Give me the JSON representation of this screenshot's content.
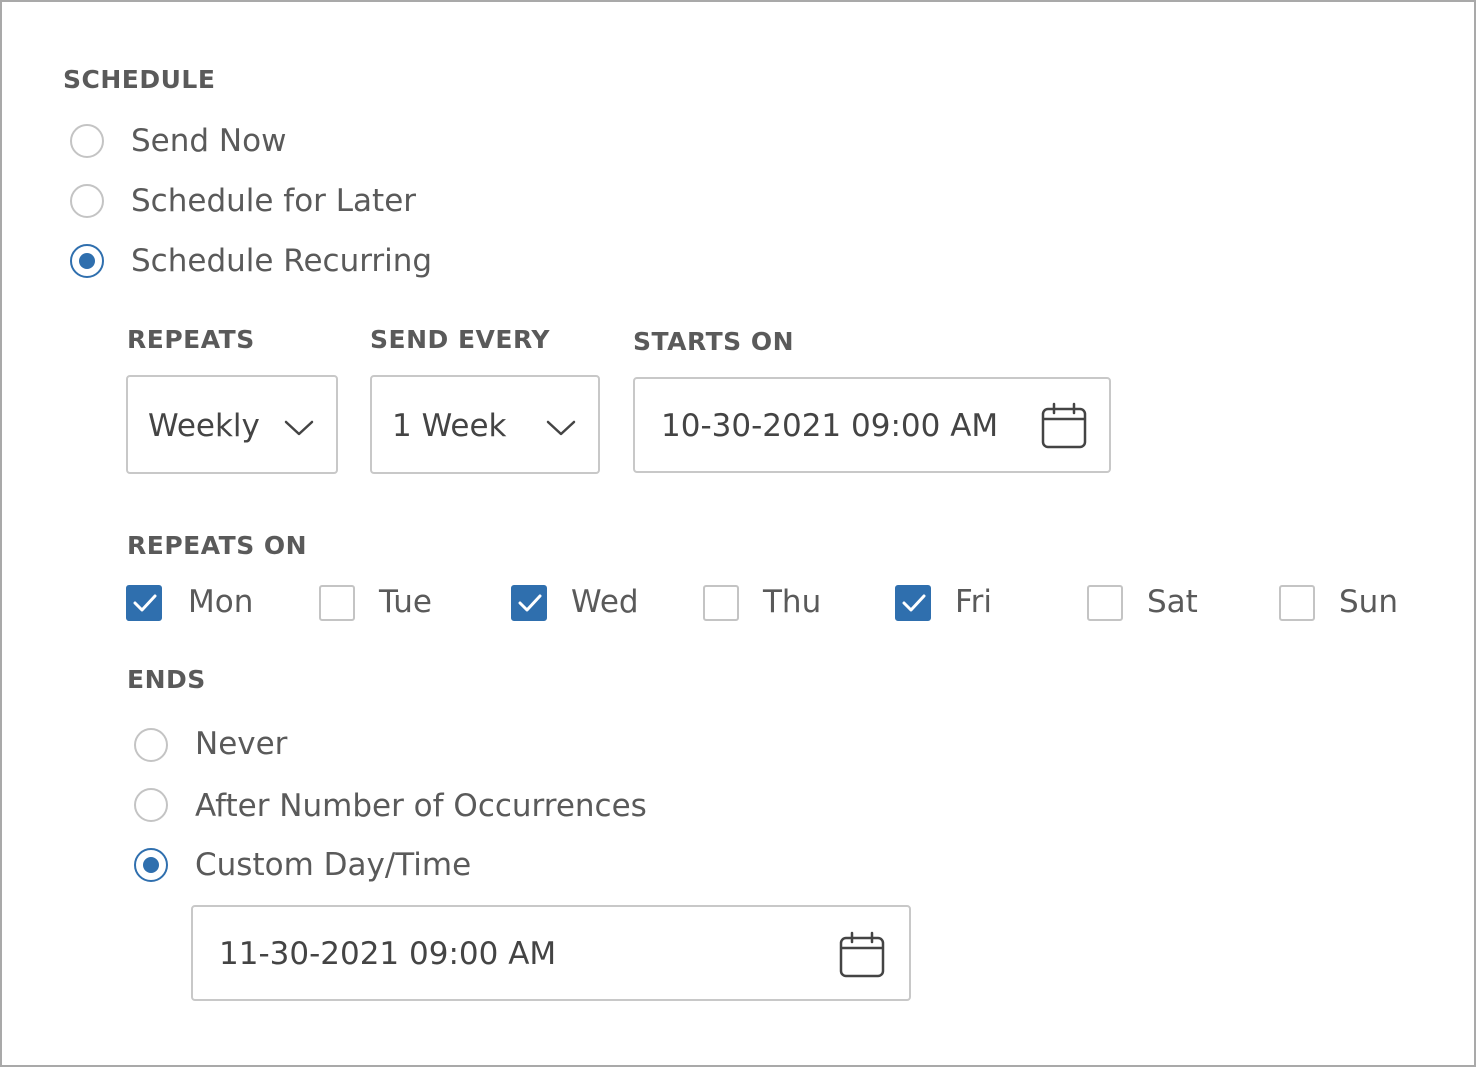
{
  "schedule": {
    "label": "SCHEDULE",
    "options": [
      {
        "label": "Send Now",
        "checked": false
      },
      {
        "label": "Schedule for Later",
        "checked": false
      },
      {
        "label": "Schedule Recurring",
        "checked": true
      }
    ]
  },
  "recurring": {
    "repeats_label": "REPEATS",
    "repeats_value": "Weekly",
    "send_every_label": "SEND EVERY",
    "send_every_value": "1 Week",
    "starts_on_label": "STARTS ON",
    "starts_on_value": "10-30-2021 09:00 AM",
    "repeats_on_label": "REPEATS ON",
    "days": [
      {
        "label": "Mon",
        "checked": true
      },
      {
        "label": "Tue",
        "checked": false
      },
      {
        "label": "Wed",
        "checked": true
      },
      {
        "label": "Thu",
        "checked": false
      },
      {
        "label": "Fri",
        "checked": true
      },
      {
        "label": "Sat",
        "checked": false
      },
      {
        "label": "Sun",
        "checked": false
      }
    ],
    "ends_label": "ENDS",
    "ends_options": [
      {
        "label": "Never",
        "checked": false
      },
      {
        "label": "After Number of Occurrences",
        "checked": false
      },
      {
        "label": "Custom Day/Time",
        "checked": true
      }
    ],
    "ends_value": "11-30-2021 09:00 AM"
  },
  "icons": {
    "dropdown": "chevron-down-icon",
    "date_picker": "calendar-icon",
    "checkmark": "checkmark-icon"
  },
  "colors": {
    "accent": "#2f6fae",
    "border": "#c8c8c8",
    "text": "#5a5a5a"
  }
}
